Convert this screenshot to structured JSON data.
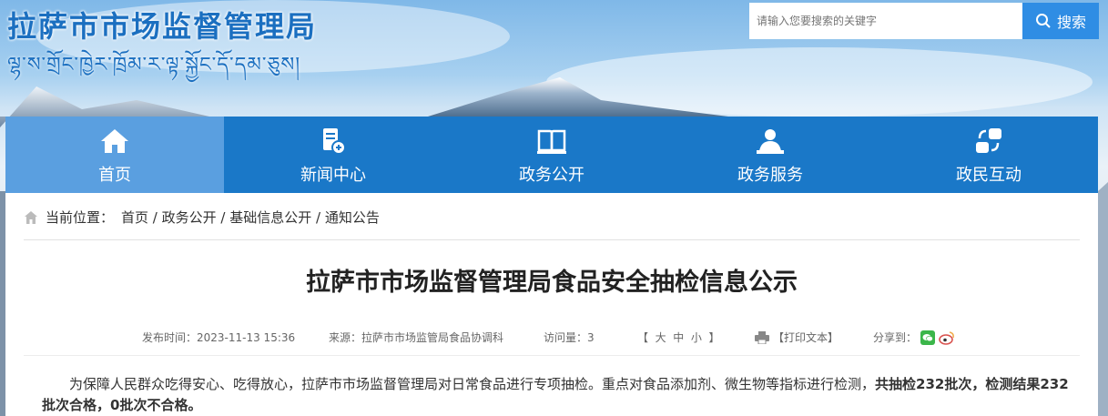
{
  "header": {
    "site_title": "拉萨市市场监督管理局",
    "site_subtitle": "ལྷ་ས་གྲོང་ཁྱེར་ཁྲོམ་ར་ལྟ་སྐྱོང་དོ་དམ་ཅུས།",
    "search_placeholder": "请输入您要搜索的关键字",
    "search_button": "搜索"
  },
  "nav": {
    "items": [
      {
        "label": "首页",
        "icon": "home-icon",
        "active": true
      },
      {
        "label": "新闻中心",
        "icon": "news-icon"
      },
      {
        "label": "政务公开",
        "icon": "book-icon"
      },
      {
        "label": "政务服务",
        "icon": "service-icon"
      },
      {
        "label": "政民互动",
        "icon": "interaction-icon"
      }
    ]
  },
  "breadcrumb": {
    "prefix": "当前位置：",
    "items": [
      "首页",
      "政务公开",
      "基础信息公开",
      "通知公告"
    ],
    "separator": " / "
  },
  "article": {
    "title": "拉萨市市场监督管理局食品安全抽检信息公示",
    "published": "发布时间：2023-11-13 15:36",
    "source": "来源：拉萨市市场监管局食品协调科",
    "views": "访问量：3",
    "font_size": "【  大  中  小  】",
    "print": "【打印文本】",
    "share": "分享到：",
    "body_part1": "为保障人民群众吃得安心、吃得放心，拉萨市市场监督管理局对日常食品进行专项抽检。重点对食品添加剂、微生物等指标进行检测，",
    "body_part2": "共抽检232批次，检测结果232批次合格，0批次不合格。"
  },
  "colors": {
    "accent": "#1a78c8",
    "nav_active": "#5a9fe0",
    "search_button": "#2f8de4",
    "title_blue": "#1b6fc0"
  }
}
